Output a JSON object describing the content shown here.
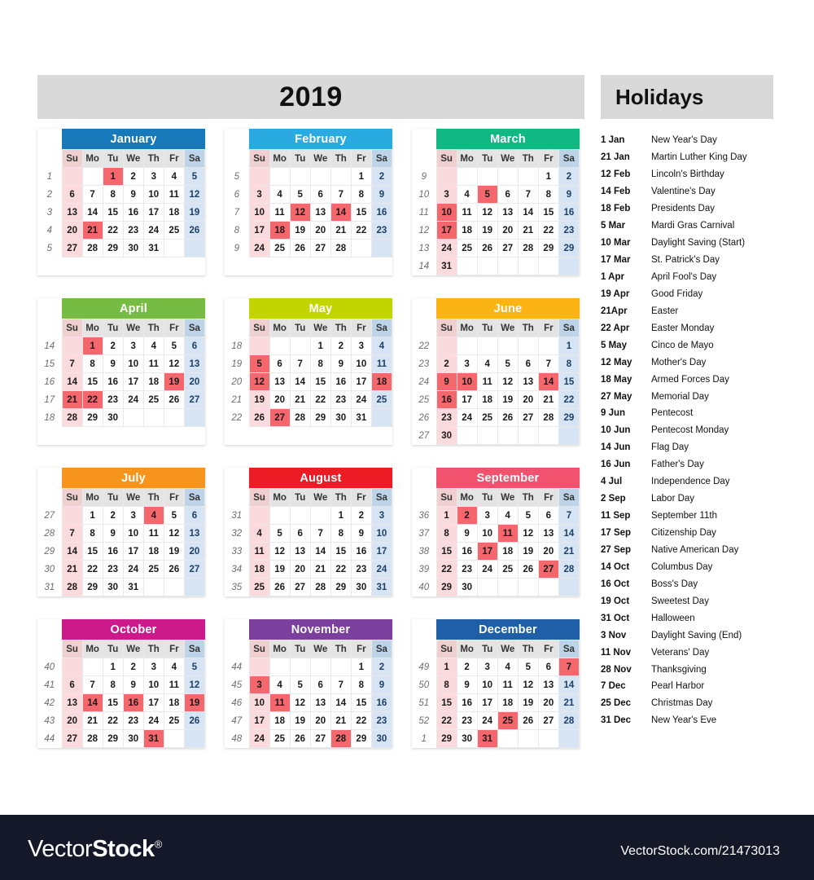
{
  "header": {
    "year_title": "2019",
    "holidays_title": "Holidays"
  },
  "weekday_labels": [
    "Su",
    "Mo",
    "Tu",
    "We",
    "Th",
    "Fr",
    "Sa"
  ],
  "colors": {
    "january": "#1779ba",
    "february": "#29abe2",
    "march": "#10b981",
    "april": "#76bc43",
    "may": "#c2d500",
    "june": "#fcb415",
    "july": "#f7941e",
    "august": "#ed1c24",
    "september": "#f1536e",
    "october": "#cc1a8a",
    "november": "#7b3f9e",
    "december": "#1f5fa8",
    "holiday_highlight": "#f4686d",
    "sunday_bg": "#fadadd",
    "saturday_bg": "#d6e4f4",
    "header_bar_bg": "#d9d9d9",
    "footer_bg": "#151828"
  },
  "months": [
    {
      "name": "January",
      "color_key": "january",
      "week_numbers": [
        "1",
        "2",
        "3",
        "4",
        "5"
      ],
      "weeks": [
        [
          "",
          "",
          "1",
          "2",
          "3",
          "4",
          "5"
        ],
        [
          "6",
          "7",
          "8",
          "9",
          "10",
          "11",
          "12"
        ],
        [
          "13",
          "14",
          "15",
          "16",
          "17",
          "18",
          "19"
        ],
        [
          "20",
          "21",
          "22",
          "23",
          "24",
          "25",
          "26"
        ],
        [
          "27",
          "28",
          "29",
          "30",
          "31",
          "",
          ""
        ]
      ],
      "holidays": [
        1,
        21
      ]
    },
    {
      "name": "February",
      "color_key": "february",
      "week_numbers": [
        "5",
        "6",
        "7",
        "8",
        "9"
      ],
      "weeks": [
        [
          "",
          "",
          "",
          "",
          "",
          "1",
          "2"
        ],
        [
          "3",
          "4",
          "5",
          "6",
          "7",
          "8",
          "9"
        ],
        [
          "10",
          "11",
          "12",
          "13",
          "14",
          "15",
          "16"
        ],
        [
          "17",
          "18",
          "19",
          "20",
          "21",
          "22",
          "23"
        ],
        [
          "24",
          "25",
          "26",
          "27",
          "28",
          "",
          ""
        ]
      ],
      "holidays": [
        12,
        14,
        18
      ]
    },
    {
      "name": "March",
      "color_key": "march",
      "week_numbers": [
        "9",
        "10",
        "11",
        "12",
        "13",
        "14"
      ],
      "weeks": [
        [
          "",
          "",
          "",
          "",
          "",
          "1",
          "2"
        ],
        [
          "3",
          "4",
          "5",
          "6",
          "7",
          "8",
          "9"
        ],
        [
          "10",
          "11",
          "12",
          "13",
          "14",
          "15",
          "16"
        ],
        [
          "17",
          "18",
          "19",
          "20",
          "21",
          "22",
          "23"
        ],
        [
          "24",
          "25",
          "26",
          "27",
          "28",
          "29",
          "29"
        ],
        [
          "31",
          "",
          "",
          "",
          "",
          "",
          ""
        ]
      ],
      "holidays": [
        5,
        10,
        17
      ]
    },
    {
      "name": "April",
      "color_key": "april",
      "week_numbers": [
        "14",
        "15",
        "16",
        "17",
        "18"
      ],
      "weeks": [
        [
          "",
          "1",
          "2",
          "3",
          "4",
          "5",
          "6"
        ],
        [
          "7",
          "8",
          "9",
          "10",
          "11",
          "12",
          "13"
        ],
        [
          "14",
          "15",
          "16",
          "17",
          "18",
          "19",
          "20"
        ],
        [
          "21",
          "22",
          "23",
          "24",
          "25",
          "26",
          "27"
        ],
        [
          "28",
          "29",
          "30",
          "",
          "",
          "",
          ""
        ]
      ],
      "holidays": [
        1,
        19,
        21,
        22
      ]
    },
    {
      "name": "May",
      "color_key": "may",
      "week_numbers": [
        "18",
        "19",
        "20",
        "21",
        "22"
      ],
      "weeks": [
        [
          "",
          "",
          "",
          "1",
          "2",
          "3",
          "4"
        ],
        [
          "5",
          "6",
          "7",
          "8",
          "9",
          "10",
          "11"
        ],
        [
          "12",
          "13",
          "14",
          "15",
          "16",
          "17",
          "18"
        ],
        [
          "19",
          "20",
          "21",
          "22",
          "23",
          "24",
          "25"
        ],
        [
          "26",
          "27",
          "28",
          "29",
          "30",
          "31",
          ""
        ]
      ],
      "holidays": [
        5,
        12,
        18,
        27
      ]
    },
    {
      "name": "June",
      "color_key": "june",
      "week_numbers": [
        "22",
        "23",
        "24",
        "25",
        "26",
        "27"
      ],
      "weeks": [
        [
          "",
          "",
          "",
          "",
          "",
          "",
          "1"
        ],
        [
          "2",
          "3",
          "4",
          "5",
          "6",
          "7",
          "8"
        ],
        [
          "9",
          "10",
          "11",
          "12",
          "13",
          "14",
          "15"
        ],
        [
          "16",
          "17",
          "18",
          "19",
          "20",
          "21",
          "22"
        ],
        [
          "23",
          "24",
          "25",
          "26",
          "27",
          "28",
          "29"
        ],
        [
          "30",
          "",
          "",
          "",
          "",
          "",
          ""
        ]
      ],
      "holidays": [
        9,
        10,
        14,
        16
      ]
    },
    {
      "name": "July",
      "color_key": "july",
      "week_numbers": [
        "27",
        "28",
        "29",
        "30",
        "31"
      ],
      "weeks": [
        [
          "",
          "1",
          "2",
          "3",
          "4",
          "5",
          "6"
        ],
        [
          "7",
          "8",
          "9",
          "10",
          "11",
          "12",
          "13"
        ],
        [
          "14",
          "15",
          "16",
          "17",
          "18",
          "19",
          "20"
        ],
        [
          "21",
          "22",
          "23",
          "24",
          "25",
          "26",
          "27"
        ],
        [
          "28",
          "29",
          "30",
          "31",
          "",
          "",
          ""
        ]
      ],
      "holidays": [
        4
      ]
    },
    {
      "name": "August",
      "color_key": "august",
      "week_numbers": [
        "31",
        "32",
        "33",
        "34",
        "35"
      ],
      "weeks": [
        [
          "",
          "",
          "",
          "",
          "1",
          "2",
          "3"
        ],
        [
          "4",
          "5",
          "6",
          "7",
          "8",
          "9",
          "10"
        ],
        [
          "11",
          "12",
          "13",
          "14",
          "15",
          "16",
          "17"
        ],
        [
          "18",
          "19",
          "20",
          "21",
          "22",
          "23",
          "24"
        ],
        [
          "25",
          "26",
          "27",
          "28",
          "29",
          "30",
          "31"
        ]
      ],
      "holidays": []
    },
    {
      "name": "September",
      "color_key": "september",
      "week_numbers": [
        "36",
        "37",
        "38",
        "39",
        "40"
      ],
      "weeks": [
        [
          "1",
          "2",
          "3",
          "4",
          "5",
          "6",
          "7"
        ],
        [
          "8",
          "9",
          "10",
          "11",
          "12",
          "13",
          "14"
        ],
        [
          "15",
          "16",
          "17",
          "18",
          "19",
          "20",
          "21"
        ],
        [
          "22",
          "23",
          "24",
          "25",
          "26",
          "27",
          "28"
        ],
        [
          "29",
          "30",
          "",
          "",
          "",
          "",
          ""
        ]
      ],
      "holidays": [
        2,
        11,
        17,
        27
      ]
    },
    {
      "name": "October",
      "color_key": "october",
      "week_numbers": [
        "40",
        "41",
        "42",
        "43",
        "44"
      ],
      "weeks": [
        [
          "",
          "",
          "1",
          "2",
          "3",
          "4",
          "5"
        ],
        [
          "6",
          "7",
          "8",
          "9",
          "10",
          "11",
          "12"
        ],
        [
          "13",
          "14",
          "15",
          "16",
          "17",
          "18",
          "19"
        ],
        [
          "20",
          "21",
          "22",
          "23",
          "24",
          "25",
          "26"
        ],
        [
          "27",
          "28",
          "29",
          "30",
          "31",
          "",
          ""
        ]
      ],
      "holidays": [
        14,
        16,
        19,
        31
      ]
    },
    {
      "name": "November",
      "color_key": "november",
      "week_numbers": [
        "44",
        "45",
        "46",
        "47",
        "48"
      ],
      "weeks": [
        [
          "",
          "",
          "",
          "",
          "",
          "1",
          "2"
        ],
        [
          "3",
          "4",
          "5",
          "6",
          "7",
          "8",
          "9"
        ],
        [
          "10",
          "11",
          "12",
          "13",
          "14",
          "15",
          "16"
        ],
        [
          "17",
          "18",
          "19",
          "20",
          "21",
          "22",
          "23"
        ],
        [
          "24",
          "25",
          "26",
          "27",
          "28",
          "29",
          "30"
        ]
      ],
      "holidays": [
        3,
        11,
        28
      ]
    },
    {
      "name": "December",
      "color_key": "december",
      "week_numbers": [
        "49",
        "50",
        "51",
        "52",
        "1"
      ],
      "weeks": [
        [
          "1",
          "2",
          "3",
          "4",
          "5",
          "6",
          "7"
        ],
        [
          "8",
          "9",
          "10",
          "11",
          "12",
          "13",
          "14"
        ],
        [
          "15",
          "16",
          "17",
          "18",
          "19",
          "20",
          "21"
        ],
        [
          "22",
          "23",
          "24",
          "25",
          "26",
          "27",
          "28"
        ],
        [
          "29",
          "30",
          "31",
          "",
          "",
          "",
          ""
        ]
      ],
      "holidays": [
        7,
        25,
        31
      ]
    }
  ],
  "holidays_list": [
    {
      "date": "1 Jan",
      "name": "New Year's Day"
    },
    {
      "date": "21 Jan",
      "name": "Martin Luther King Day"
    },
    {
      "date": "12 Feb",
      "name": "Lincoln's Birthday"
    },
    {
      "date": "14 Feb",
      "name": "Valentine's Day"
    },
    {
      "date": "18 Feb",
      "name": "Presidents Day"
    },
    {
      "date": "5 Mar",
      "name": "Mardi Gras Carnival"
    },
    {
      "date": "10 Mar",
      "name": "Daylight Saving (Start)"
    },
    {
      "date": "17 Mar",
      "name": "St. Patrick's Day"
    },
    {
      "date": "1 Apr",
      "name": "April Fool's Day"
    },
    {
      "date": "19 Apr",
      "name": "Good Friday"
    },
    {
      "date": "21Apr",
      "name": "Easter"
    },
    {
      "date": "22 Apr",
      "name": "Easter Monday"
    },
    {
      "date": "5 May",
      "name": "Cinco de Mayo"
    },
    {
      "date": "12 May",
      "name": "Mother's Day"
    },
    {
      "date": "18 May",
      "name": "Armed Forces Day"
    },
    {
      "date": "27 May",
      "name": "Memorial Day"
    },
    {
      "date": "9 Jun",
      "name": "Pentecost"
    },
    {
      "date": "10 Jun",
      "name": "Pentecost Monday"
    },
    {
      "date": "14 Jun",
      "name": "Flag Day"
    },
    {
      "date": "16 Jun",
      "name": "Father's Day"
    },
    {
      "date": "4 Jul",
      "name": "Independence Day"
    },
    {
      "date": "2 Sep",
      "name": "Labor Day"
    },
    {
      "date": "11 Sep",
      "name": "September 11th"
    },
    {
      "date": "17 Sep",
      "name": "Citizenship Day"
    },
    {
      "date": "27 Sep",
      "name": "Native American Day"
    },
    {
      "date": "14 Oct",
      "name": "Columbus Day"
    },
    {
      "date": "16 Oct",
      "name": "Boss's Day"
    },
    {
      "date": "19 Oct",
      "name": "Sweetest Day"
    },
    {
      "date": "31 Oct",
      "name": "Halloween"
    },
    {
      "date": "3 Nov",
      "name": "Daylight Saving (End)"
    },
    {
      "date": "11 Nov",
      "name": "Veterans' Day"
    },
    {
      "date": "28 Nov",
      "name": "Thanksgiving"
    },
    {
      "date": "7 Dec",
      "name": "Pearl Harbor"
    },
    {
      "date": "25 Dec",
      "name": "Christmas Day"
    },
    {
      "date": "31 Dec",
      "name": "New Year's Eve"
    }
  ],
  "footer": {
    "logo_light": "Vector",
    "logo_bold": "Stock",
    "logo_reg": "®",
    "url": "VectorStock.com/21473013"
  }
}
